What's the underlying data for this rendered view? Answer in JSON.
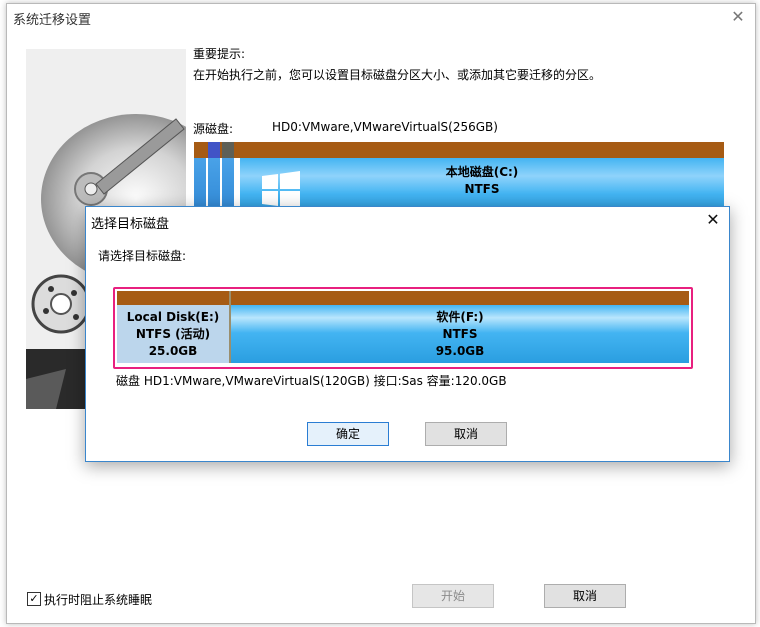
{
  "window": {
    "title": "系统迁移设置",
    "notice_title": "重要提示:",
    "notice_body": "在开始执行之前，您可以设置目标磁盘分区大小、或添加其它要迁移的分区。",
    "source_label": "源磁盘:",
    "source_value": "HD0:VMware,VMwareVirtualS(256GB)",
    "source_partition": {
      "name": "本地磁盘(C:)",
      "fs": "NTFS"
    },
    "checkbox_label": "执行时阻止系统睡眠",
    "checkbox_checked": true,
    "start_label": "开始",
    "cancel_label": "取消"
  },
  "dialog": {
    "title": "选择目标磁盘",
    "prompt": "请选择目标磁盘:",
    "partitions": [
      {
        "name": "Local Disk(E:)",
        "fs": "NTFS (活动)",
        "size": "25.0GB"
      },
      {
        "name": "软件(F:)",
        "fs": "NTFS",
        "size": "95.0GB"
      }
    ],
    "disk_info": "磁盘 HD1:VMware,VMwareVirtualS(120GB)  接口:Sas  容量:120.0GB",
    "ok_label": "确定",
    "cancel_label": "取消"
  },
  "colors": {
    "partition_stripe": "#a65b14",
    "selection_border": "#e8207f",
    "partition_blue": "#43b4f2"
  }
}
